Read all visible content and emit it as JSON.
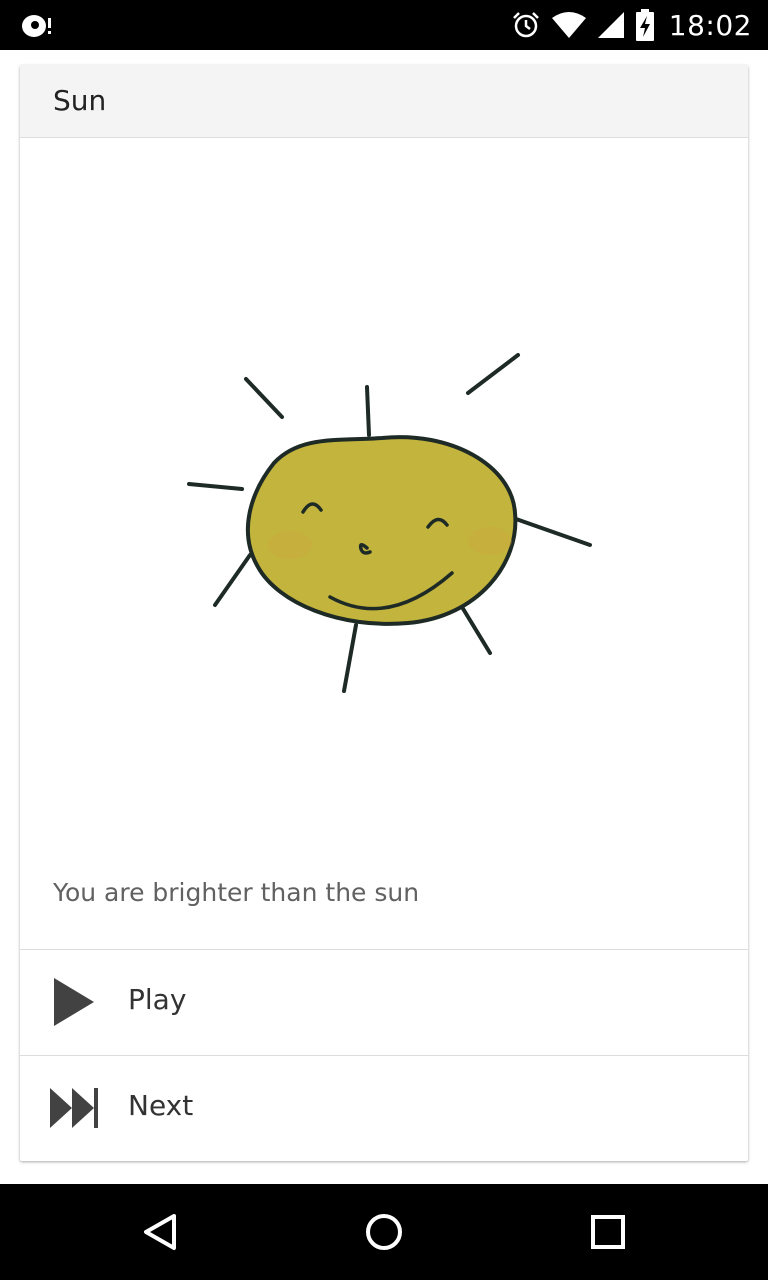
{
  "status_bar": {
    "time": "18:02",
    "icons": [
      "notification-icon",
      "alarm-icon",
      "wifi-icon",
      "cellular-signal-icon",
      "battery-charging-icon"
    ]
  },
  "card": {
    "title": "Sun",
    "caption": "You are brighter than the sun",
    "illustration": "sun-drawing",
    "colors": {
      "sun_fill": "#c2b43d",
      "sun_stroke": "#1e2a25",
      "header_bg": "#f4f4f4"
    },
    "actions": [
      {
        "label": "Play",
        "icon": "play-icon"
      },
      {
        "label": "Next",
        "icon": "skip-next-icon"
      }
    ]
  },
  "nav_bar": {
    "buttons": [
      "back-icon",
      "home-icon",
      "recents-icon"
    ]
  }
}
